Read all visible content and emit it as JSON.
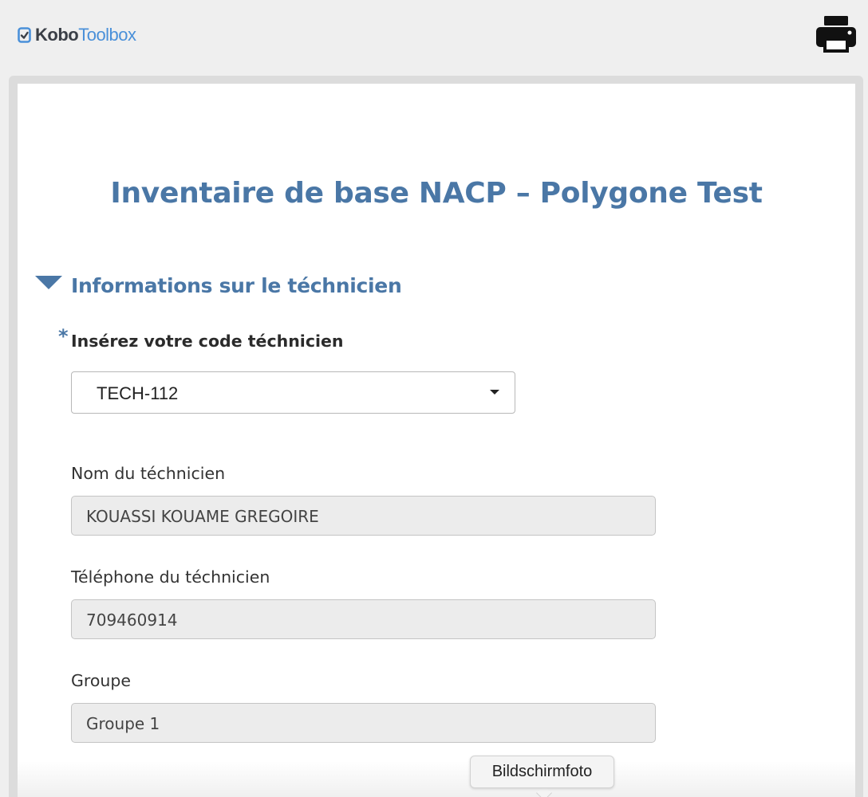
{
  "header": {
    "logo_kobo": "Kobo",
    "logo_toolbox": "Toolbox",
    "print_icon": "printer-icon"
  },
  "form": {
    "title": "Inventaire de base NACP – Polygone Test",
    "group": {
      "collapse_icon": "triangle-down-icon",
      "title": "Informations sur le téchnicien"
    },
    "questions": {
      "tech_code": {
        "required_mark": "*",
        "label": "Insérez votre code téchnicien",
        "value": "TECH-112"
      },
      "tech_name": {
        "label": "Nom du téchnicien",
        "value": "KOUASSI KOUAME GREGOIRE"
      },
      "tech_phone": {
        "label": "Téléphone du téchnicien",
        "value": "709460914"
      },
      "group": {
        "label": "Groupe",
        "value": "Groupe 1"
      }
    }
  },
  "tooltip": {
    "text": "Bildschirmfoto"
  },
  "colors": {
    "accent": "#4a77a6",
    "brand_blue": "#4a90d9",
    "background": "#efefef",
    "readonly_field": "#ececec"
  }
}
